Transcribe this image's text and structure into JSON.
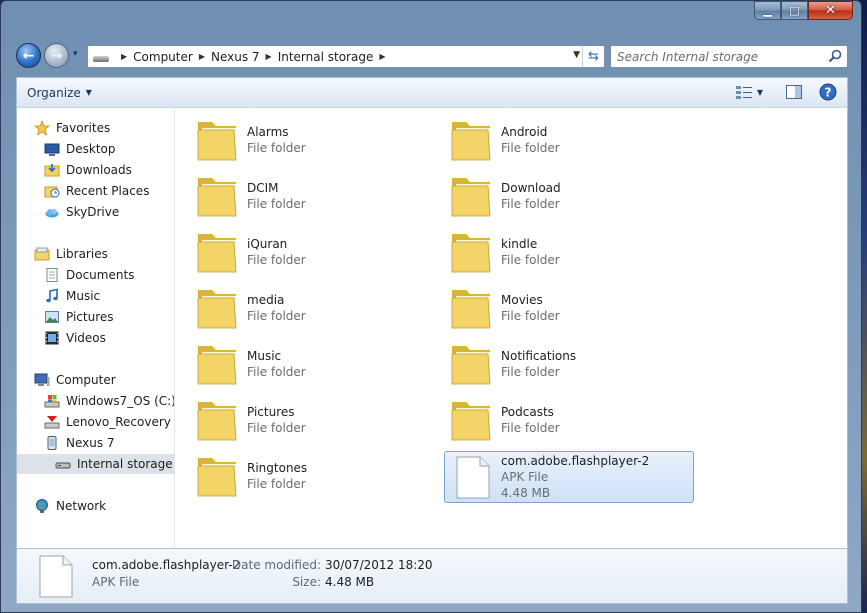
{
  "window": {
    "minimize_glyph": "▁",
    "maximize_glyph": "□",
    "close_glyph": "✕"
  },
  "nav": {
    "back_glyph": "←",
    "forward_glyph": "→",
    "history_glyph": "▾"
  },
  "address": {
    "crumbs": [
      "Computer",
      "Nexus 7",
      "Internal storage"
    ],
    "separator": "▶",
    "dropdown_glyph": "▼",
    "refresh_glyph": "⇆"
  },
  "search": {
    "placeholder": "Search Internal storage"
  },
  "toolbar": {
    "organize_label": "Organize",
    "organize_arrow": "▼",
    "views_arrow": "▼"
  },
  "navpane": {
    "favorites": {
      "label": "Favorites",
      "items": [
        "Desktop",
        "Downloads",
        "Recent Places",
        "SkyDrive"
      ]
    },
    "libraries": {
      "label": "Libraries",
      "items": [
        "Documents",
        "Music",
        "Pictures",
        "Videos"
      ]
    },
    "computer": {
      "label": "Computer",
      "items": [
        "Windows7_OS (C:)",
        "Lenovo_Recovery (Q",
        "Nexus 7",
        "Internal storage"
      ]
    },
    "network": {
      "label": "Network"
    }
  },
  "files": [
    {
      "name": "Alarms",
      "type": "File folder"
    },
    {
      "name": "Android",
      "type": "File folder"
    },
    {
      "name": "DCIM",
      "type": "File folder"
    },
    {
      "name": "Download",
      "type": "File folder"
    },
    {
      "name": "iQuran",
      "type": "File folder"
    },
    {
      "name": "kindle",
      "type": "File folder"
    },
    {
      "name": "media",
      "type": "File folder"
    },
    {
      "name": "Movies",
      "type": "File folder"
    },
    {
      "name": "Music",
      "type": "File folder"
    },
    {
      "name": "Notifications",
      "type": "File folder"
    },
    {
      "name": "Pictures",
      "type": "File folder"
    },
    {
      "name": "Podcasts",
      "type": "File folder"
    },
    {
      "name": "Ringtones",
      "type": "File folder"
    }
  ],
  "selected_file": {
    "name": "com.adobe.flashplayer-2",
    "type": "APK File",
    "size": "4.48 MB"
  },
  "details": {
    "name": "com.adobe.flashplayer-2",
    "type": "APK File",
    "date_label": "Date modified:",
    "date_value": "30/07/2012 18:20",
    "size_label": "Size:",
    "size_value": "4.48 MB"
  },
  "colors": {
    "folder": "#f2d467",
    "folder_dark": "#d9b43a",
    "selection_border": "#7da2ce",
    "accent_link": "#2e6bb8"
  }
}
